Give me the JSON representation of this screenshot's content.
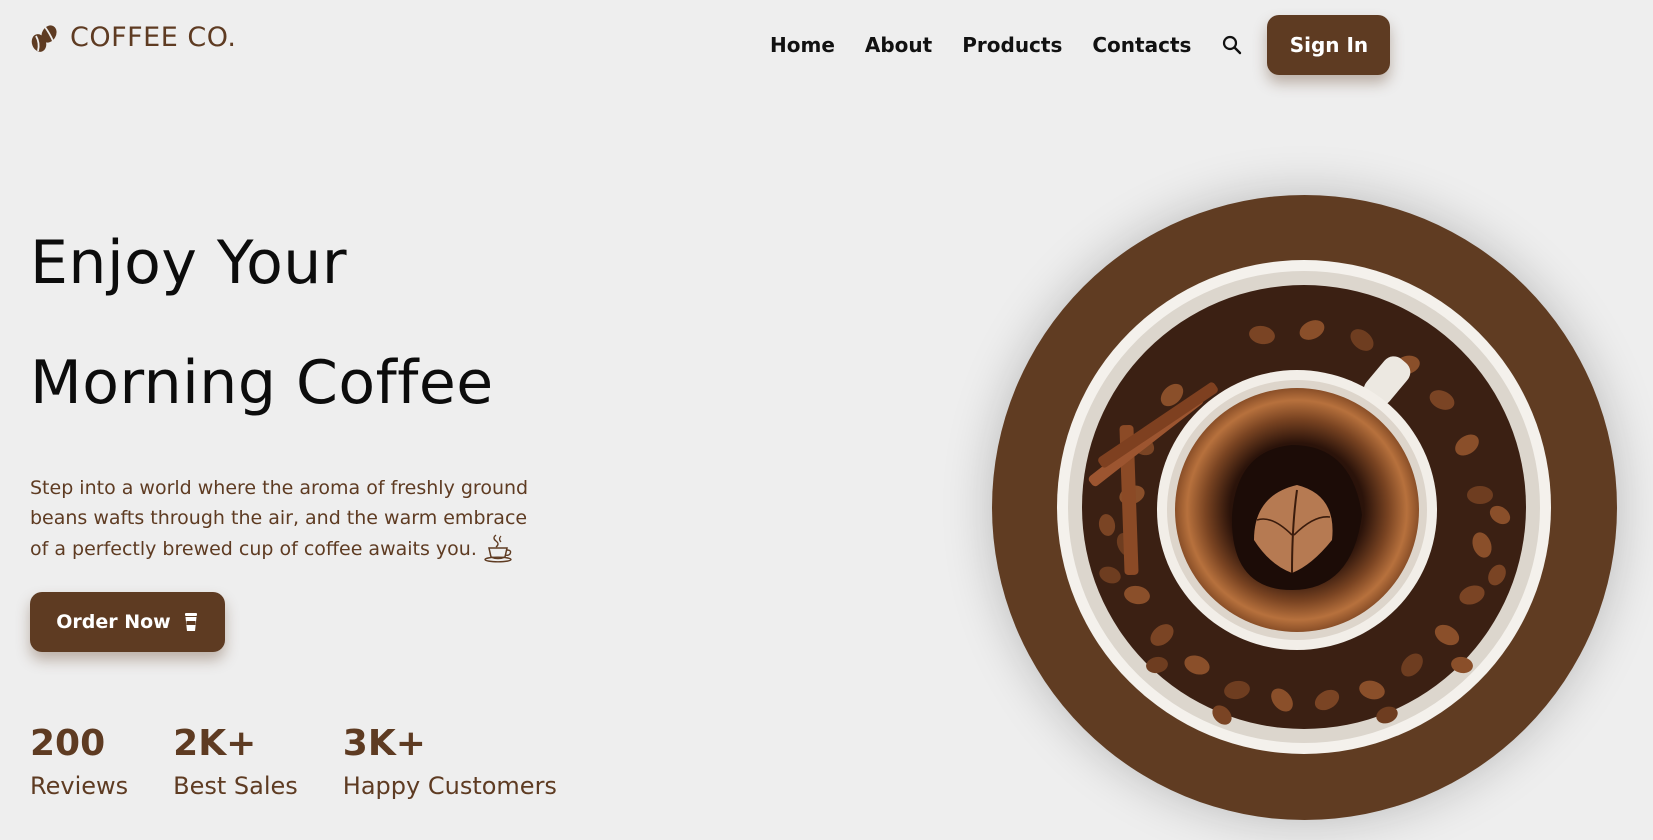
{
  "brand": {
    "name": "COFFEE CO.",
    "icon": "coffee-beans-icon"
  },
  "nav": {
    "links": [
      "Home",
      "About",
      "Products",
      "Contacts"
    ],
    "search_icon": "search-icon",
    "signin_label": "Sign In"
  },
  "hero": {
    "title_line1": "Enjoy Your",
    "title_line2": "Morning Coffee",
    "description": "Step into a world where the aroma of freshly ground beans wafts through the air, and the warm embrace of a perfectly brewed cup of coffee awaits you.",
    "order_label": "Order Now",
    "order_icon": "coffee-cup-icon"
  },
  "stats": [
    {
      "value": "200",
      "label": "Reviews"
    },
    {
      "value": "2K+",
      "label": "Best Sales"
    },
    {
      "value": "3K+",
      "label": "Happy Customers"
    }
  ],
  "colors": {
    "accent": "#5e3b22",
    "background": "#eeeeee",
    "text": "#111111"
  }
}
